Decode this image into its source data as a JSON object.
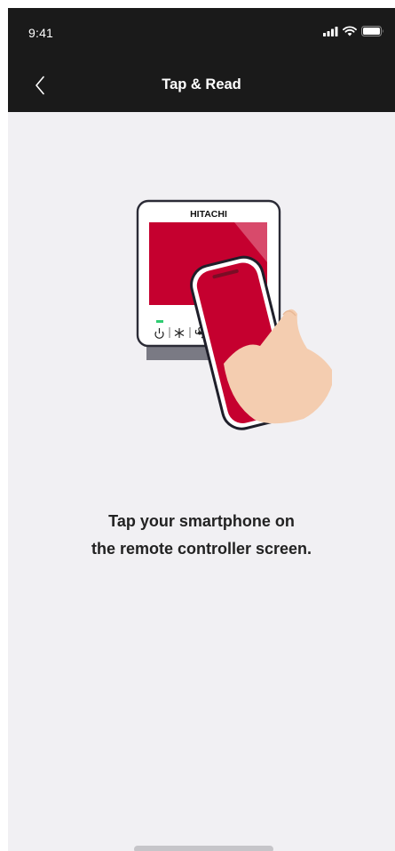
{
  "status_bar": {
    "time": "9:41",
    "icons": [
      "signal-icon",
      "wifi-icon",
      "battery-icon"
    ]
  },
  "nav": {
    "title": "Tap & Read",
    "back_icon": "chevron-left-icon"
  },
  "illustration": {
    "brand_label": "HITACHI",
    "accent_color": "#c5002f",
    "skin_color": "#f4cdb0"
  },
  "instruction": {
    "line1": "Tap your smartphone on",
    "line2": "the remote controller screen."
  }
}
